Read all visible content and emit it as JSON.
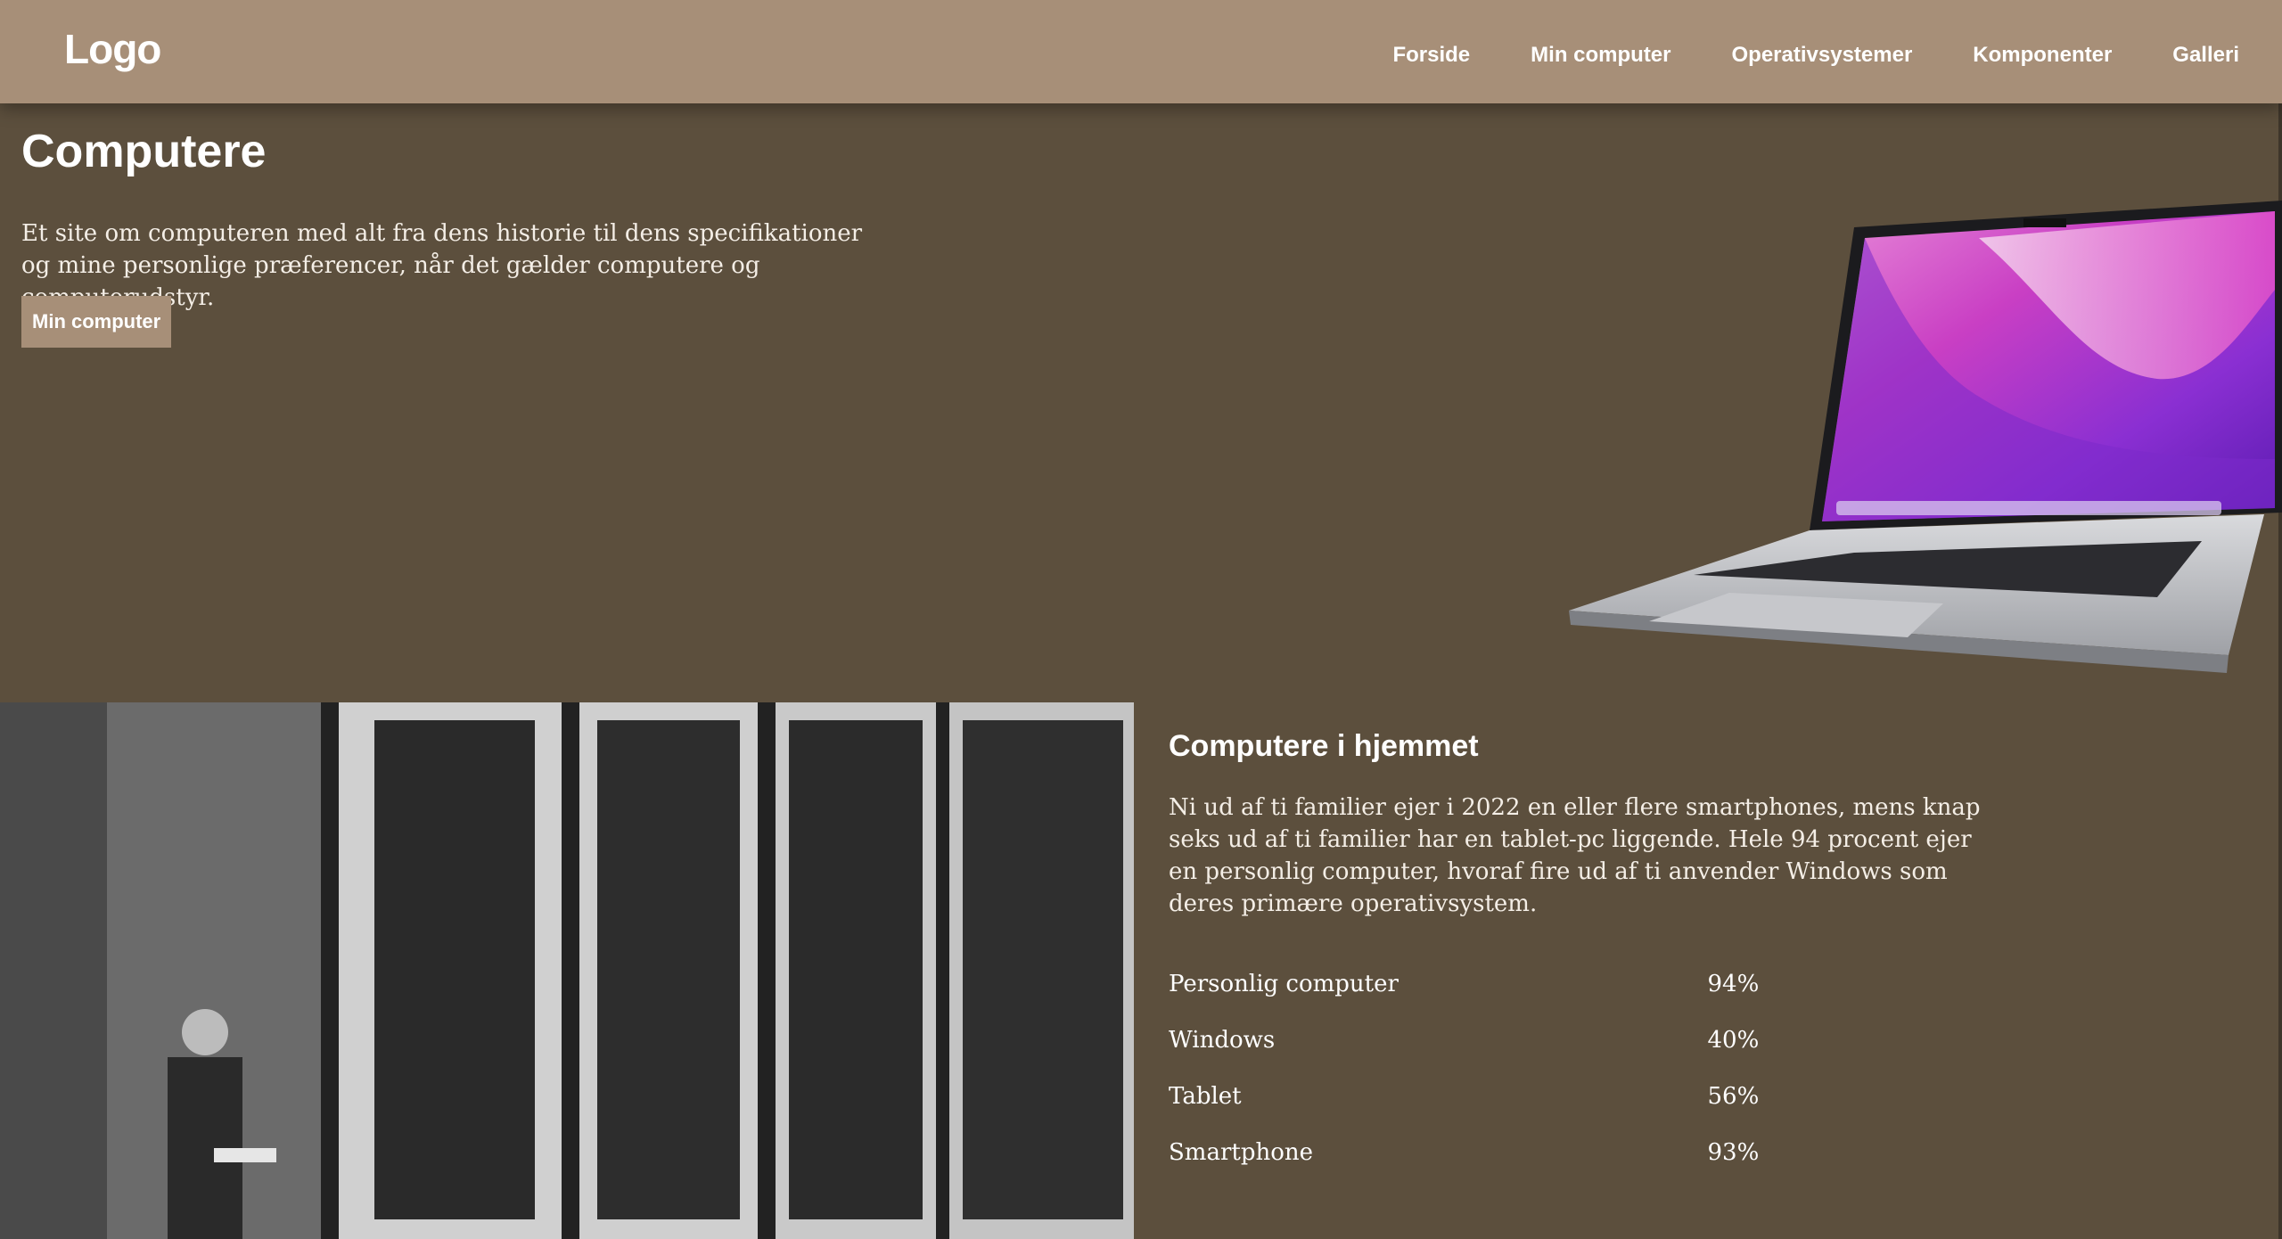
{
  "header": {
    "logo": "Logo",
    "nav": [
      "Forside",
      "Min computer",
      "Operativsystemer",
      "Komponenter",
      "Galleri"
    ]
  },
  "hero": {
    "title": "Computere",
    "description": "Et site om computeren med alt fra dens historie til dens specifikationer og mine personlige præferencer, når det gælder computere og computerudstyr.",
    "button": "Min computer"
  },
  "section": {
    "title": "Computere i hjemmet",
    "body": "Ni ud af ti familier ejer i 2022 en eller flere smartphones, mens knap seks ud af ti familier har en tablet-pc liggende. Hele 94 procent ejer en personlig computer, hvoraf fire ud af ti anvender Windows som deres primære operativsystem.",
    "stats": [
      {
        "label": "Personlig computer",
        "value": "94%"
      },
      {
        "label": "Windows",
        "value": "40%"
      },
      {
        "label": "Tablet",
        "value": "56%"
      },
      {
        "label": "Smartphone",
        "value": "93%"
      }
    ]
  },
  "colors": {
    "header_bg": "#a78f78",
    "page_bg": "#5c4f3d",
    "button_bg": "#a78f78"
  }
}
